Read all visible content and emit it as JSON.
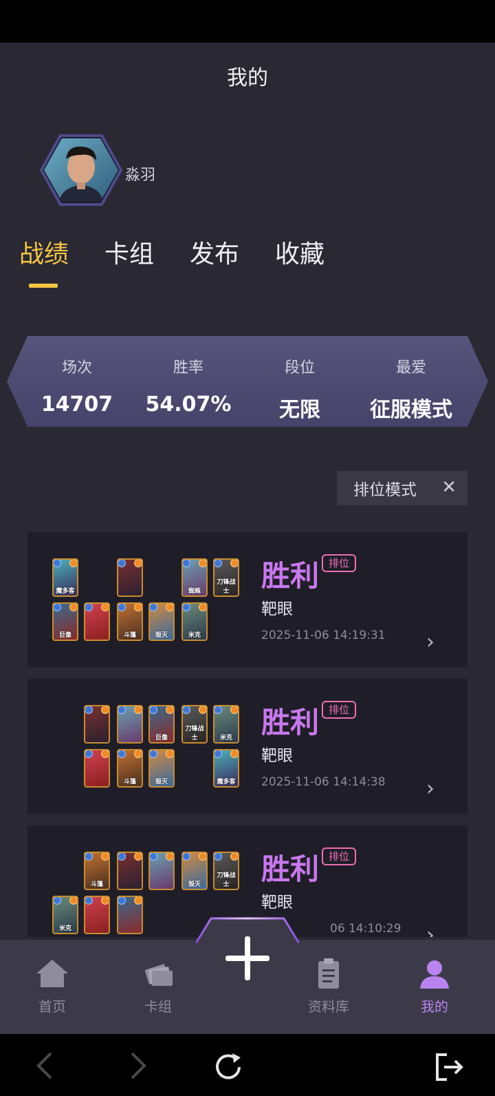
{
  "header": {
    "title": "我的"
  },
  "profile": {
    "username": "淼羽",
    "avatar_icon": "hero-portrait-avatar"
  },
  "tabs": [
    {
      "label": "战绩",
      "active": true
    },
    {
      "label": "卡组",
      "active": false
    },
    {
      "label": "发布",
      "active": false
    },
    {
      "label": "收藏",
      "active": false
    }
  ],
  "stats": [
    {
      "label": "场次",
      "value": "14707"
    },
    {
      "label": "胜率",
      "value": "54.07%"
    },
    {
      "label": "段位",
      "value": "无限"
    },
    {
      "label": "最爱",
      "value": "征服模式"
    }
  ],
  "filter": {
    "label": "排位模式",
    "close_icon": "close-icon"
  },
  "matches": [
    {
      "result": "胜利",
      "badge": "排位",
      "opponent": "靶眼",
      "time": "2025-11-06 14:19:31",
      "cards": [
        "魔多客",
        "",
        "",
        "蜘蛛",
        "刀锋战士",
        "巨像",
        "",
        "斗篷",
        "毁灭",
        "米克"
      ]
    },
    {
      "result": "胜利",
      "badge": "排位",
      "opponent": "靶眼",
      "time": "2025-11-06 14:14:38",
      "cards": [
        "",
        "",
        "巨像",
        "刀锋战士",
        "米克",
        "",
        "斗篷",
        "毁灭",
        "魔多客"
      ]
    },
    {
      "result": "胜利",
      "badge": "排位",
      "opponent": "靶眼",
      "time": "06 14:10:29",
      "cards": [
        "斗篷",
        "",
        "",
        "毁灭",
        "刀锋战士",
        "米克",
        "",
        ""
      ]
    }
  ],
  "nav": [
    {
      "label": "首页",
      "icon": "home-icon",
      "active": false
    },
    {
      "label": "卡组",
      "icon": "cards-icon",
      "active": false
    },
    {
      "label": "资料库",
      "icon": "clipboard-icon",
      "active": false
    },
    {
      "label": "我的",
      "icon": "profile-icon",
      "active": true
    }
  ],
  "colors": {
    "accent": "#f3c541",
    "win": "#c978ee",
    "badge": "#ec6fb8",
    "nav_active": "#b984ef"
  }
}
